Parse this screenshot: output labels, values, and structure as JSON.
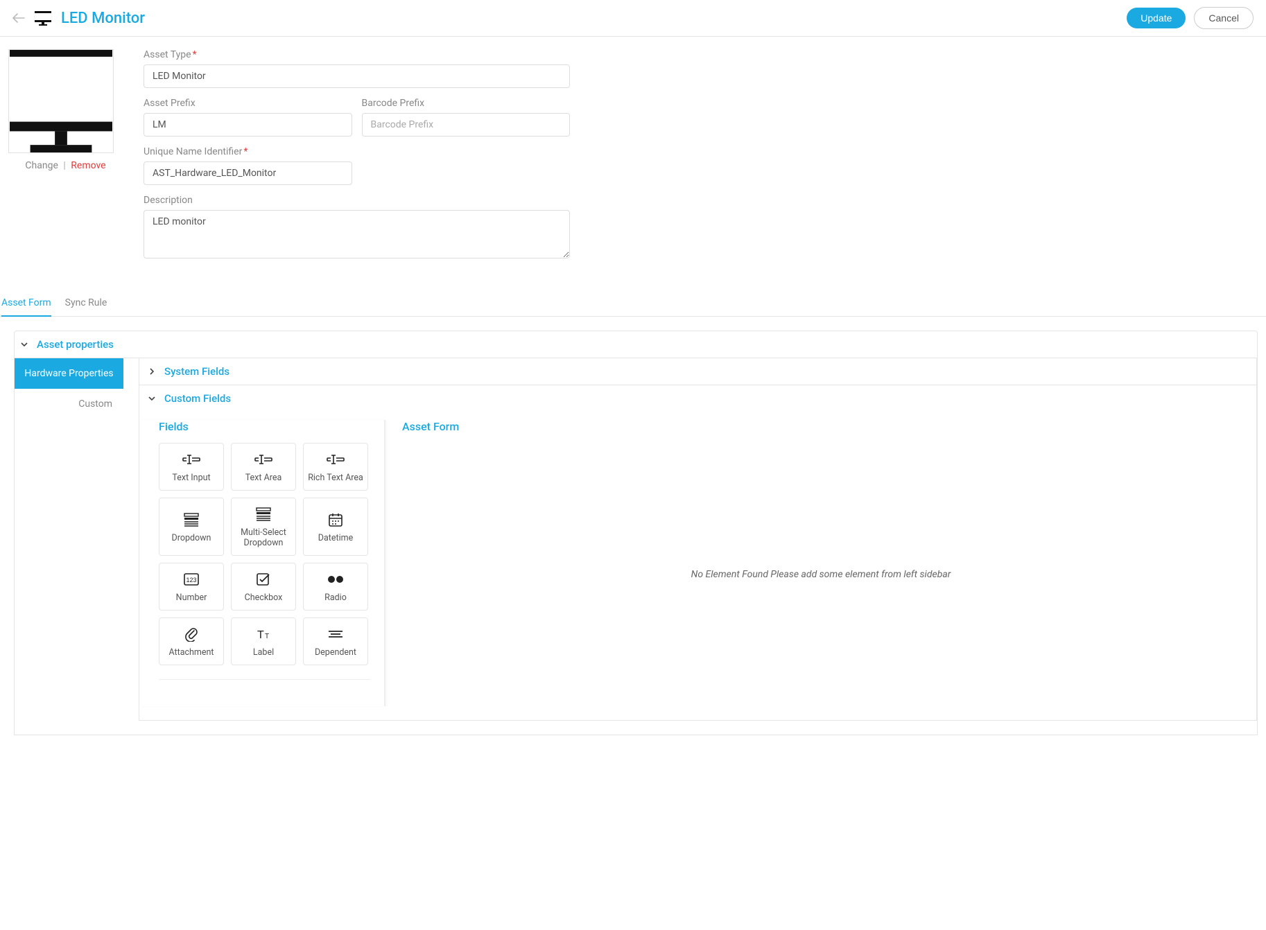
{
  "header": {
    "title": "LED Monitor",
    "update_label": "Update",
    "cancel_label": "Cancel"
  },
  "image": {
    "change_label": "Change",
    "remove_label": "Remove"
  },
  "form": {
    "asset_type_label": "Asset Type",
    "asset_type_value": "LED Monitor",
    "asset_prefix_label": "Asset Prefix",
    "asset_prefix_value": "LM",
    "barcode_prefix_label": "Barcode Prefix",
    "barcode_prefix_value": "",
    "barcode_prefix_placeholder": "Barcode Prefix",
    "unique_name_label": "Unique Name Identifier",
    "unique_name_value": "AST_Hardware_LED_Monitor",
    "description_label": "Description",
    "description_value": "LED monitor"
  },
  "tabs": {
    "asset_form": "Asset Form",
    "sync_rule": "Sync Rule"
  },
  "accordion": {
    "asset_properties": "Asset properties",
    "hardware_properties": "Hardware Properties",
    "custom": "Custom",
    "system_fields": "System Fields",
    "custom_fields": "Custom Fields"
  },
  "fields_panel": {
    "heading": "Fields",
    "items": [
      "Text Input",
      "Text Area",
      "Rich Text Area",
      "Dropdown",
      "Multi-Select Dropdown",
      "Datetime",
      "Number",
      "Checkbox",
      "Radio",
      "Attachment",
      "Label",
      "Dependent"
    ]
  },
  "asset_form_panel": {
    "heading": "Asset Form",
    "empty": "No Element Found Please add some element from left sidebar"
  }
}
